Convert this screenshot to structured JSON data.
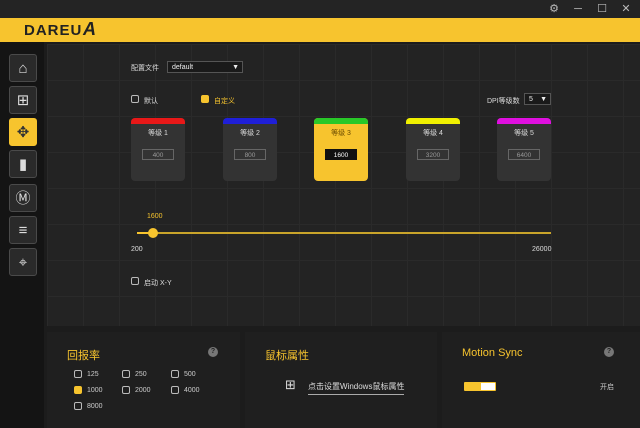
{
  "window": {
    "controls": [
      "gear-icon",
      "minimize-icon",
      "maximize-icon",
      "close-icon"
    ],
    "control_glyphs": [
      "⚙",
      "─",
      "☐",
      "✕"
    ]
  },
  "brand": {
    "logo": "DAREU",
    "mark": "A"
  },
  "sidebar": {
    "items": [
      {
        "name": "home",
        "glyph": "⌂"
      },
      {
        "name": "add-macro",
        "glyph": "⊞"
      },
      {
        "name": "dpi",
        "glyph": "✥",
        "active": true
      },
      {
        "name": "battery",
        "glyph": "▮"
      },
      {
        "name": "macro-m",
        "glyph": "Ⓜ"
      },
      {
        "name": "list",
        "glyph": "≡"
      },
      {
        "name": "crosshair",
        "glyph": "⌖"
      }
    ]
  },
  "profile": {
    "label": "配置文件",
    "value": "default"
  },
  "mode": {
    "default_label": "默认",
    "custom_label": "自定义",
    "selected": "custom"
  },
  "dpi_levels": {
    "label": "DPI等级数",
    "value": "5"
  },
  "cards": [
    {
      "title": "等级  1",
      "value": "400",
      "color": "#e81818"
    },
    {
      "title": "等级  2",
      "value": "800",
      "color": "#1f1fd8"
    },
    {
      "title": "等级  3",
      "value": "1600",
      "color": "#28c828",
      "active": true
    },
    {
      "title": "等级  4",
      "value": "3200",
      "color": "#f0f000"
    },
    {
      "title": "等级  5",
      "value": "6400",
      "color": "#e010e0"
    }
  ],
  "slider": {
    "current": "1600",
    "min": "200",
    "max": "26000",
    "fraction": 0.057
  },
  "xy": {
    "label": "启动 X-Y"
  },
  "polling": {
    "title": "回报率",
    "help": "?",
    "options": [
      "125",
      "250",
      "500",
      "1000",
      "2000",
      "4000",
      "8000"
    ],
    "selected": "1000"
  },
  "mouse": {
    "title": "鼠标属性",
    "link": "点击设置Windows鼠标属性"
  },
  "motion": {
    "title": "Motion Sync",
    "help": "?",
    "state": "开启",
    "on": true
  },
  "accent_color": "#f7c42e"
}
